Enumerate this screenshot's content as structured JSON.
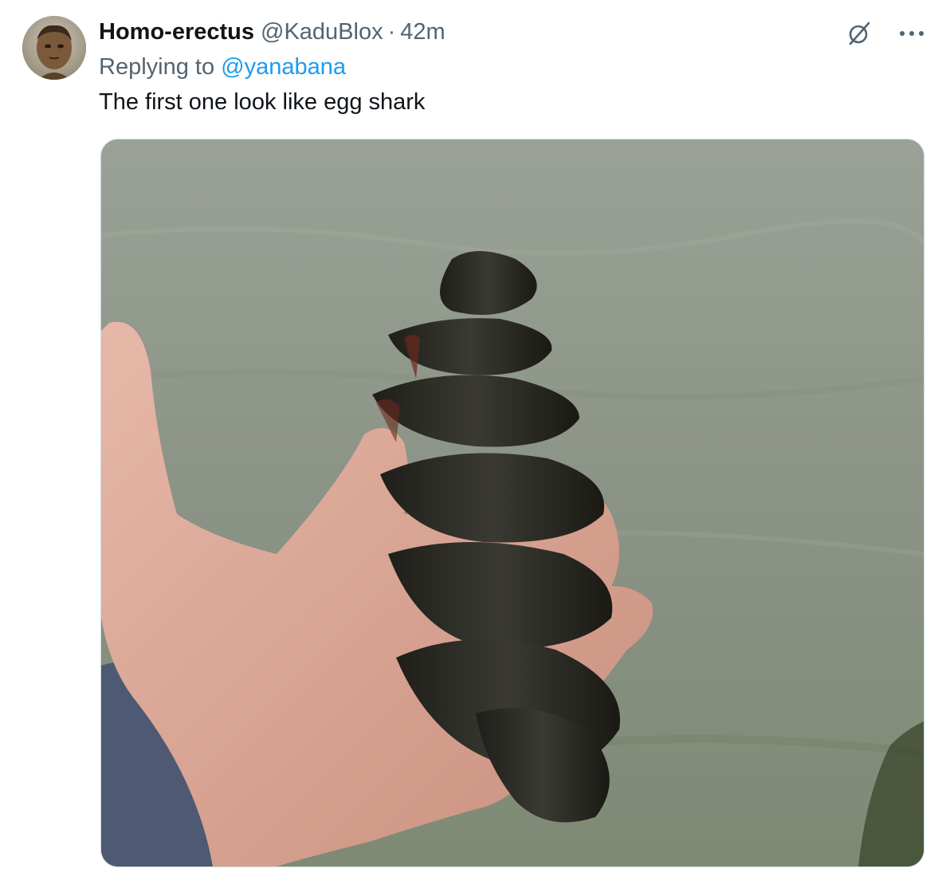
{
  "tweet": {
    "author": {
      "name": "Homo-erectus",
      "handle": "@KaduBlox",
      "avatar_icon": "avatar-image"
    },
    "separator": "·",
    "time": "42m",
    "reply": {
      "prefix": "Replying to",
      "mention": "@yanabana"
    },
    "text": "The first one look like egg shark",
    "actions": {
      "grok_icon": "slashed-circle-icon",
      "more_icon": "more-options-icon"
    },
    "media": {
      "kind": "photo"
    }
  },
  "colors": {
    "text_primary": "#0f1419",
    "text_secondary": "#536471",
    "link": "#1d9bf0",
    "border": "#cfd9de"
  }
}
